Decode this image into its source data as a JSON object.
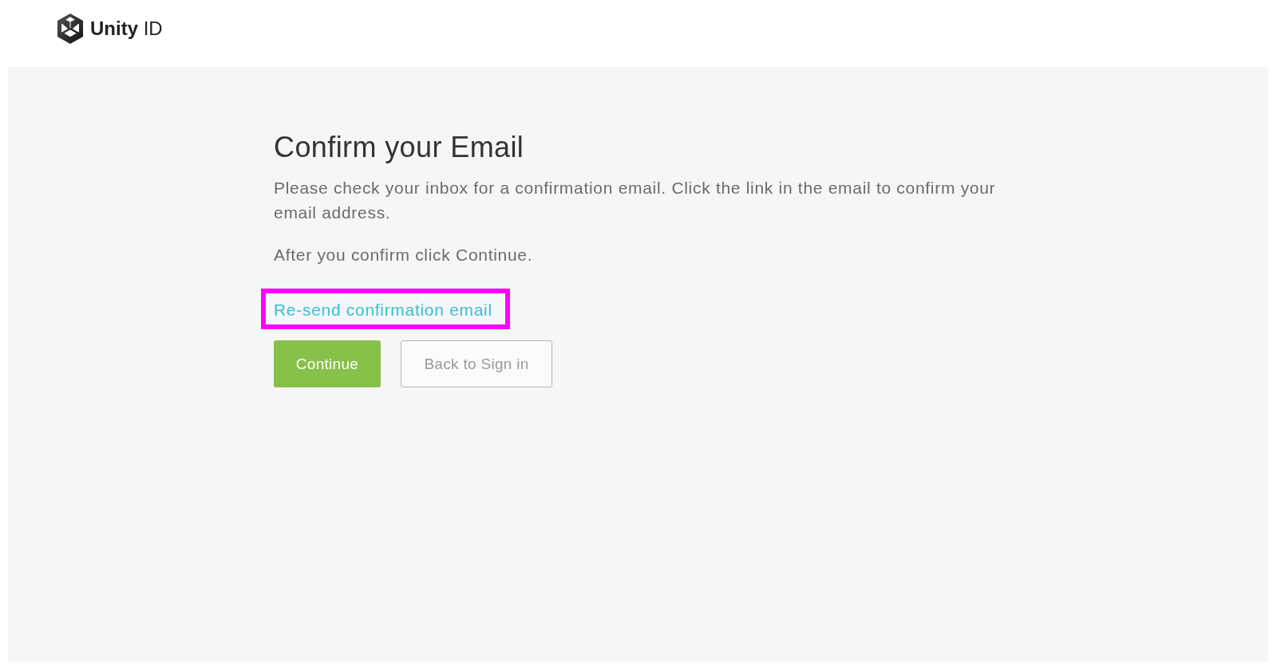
{
  "header": {
    "logo_text": "**Unity** ID"
  },
  "page": {
    "title": "Confirm your Email",
    "paragraphs": [
      "Please check your inbox for a confirmation email. Click the link in the email to confirm your email address.",
      "After you confirm click Continue."
    ],
    "resend_link": {
      "label": "Re-send confirmation email",
      "highlighted": true
    },
    "buttons": [
      {
        "label": "Continue",
        "kind": "primary"
      },
      {
        "label": "Back to Sign in",
        "kind": "secondary"
      }
    ]
  }
}
